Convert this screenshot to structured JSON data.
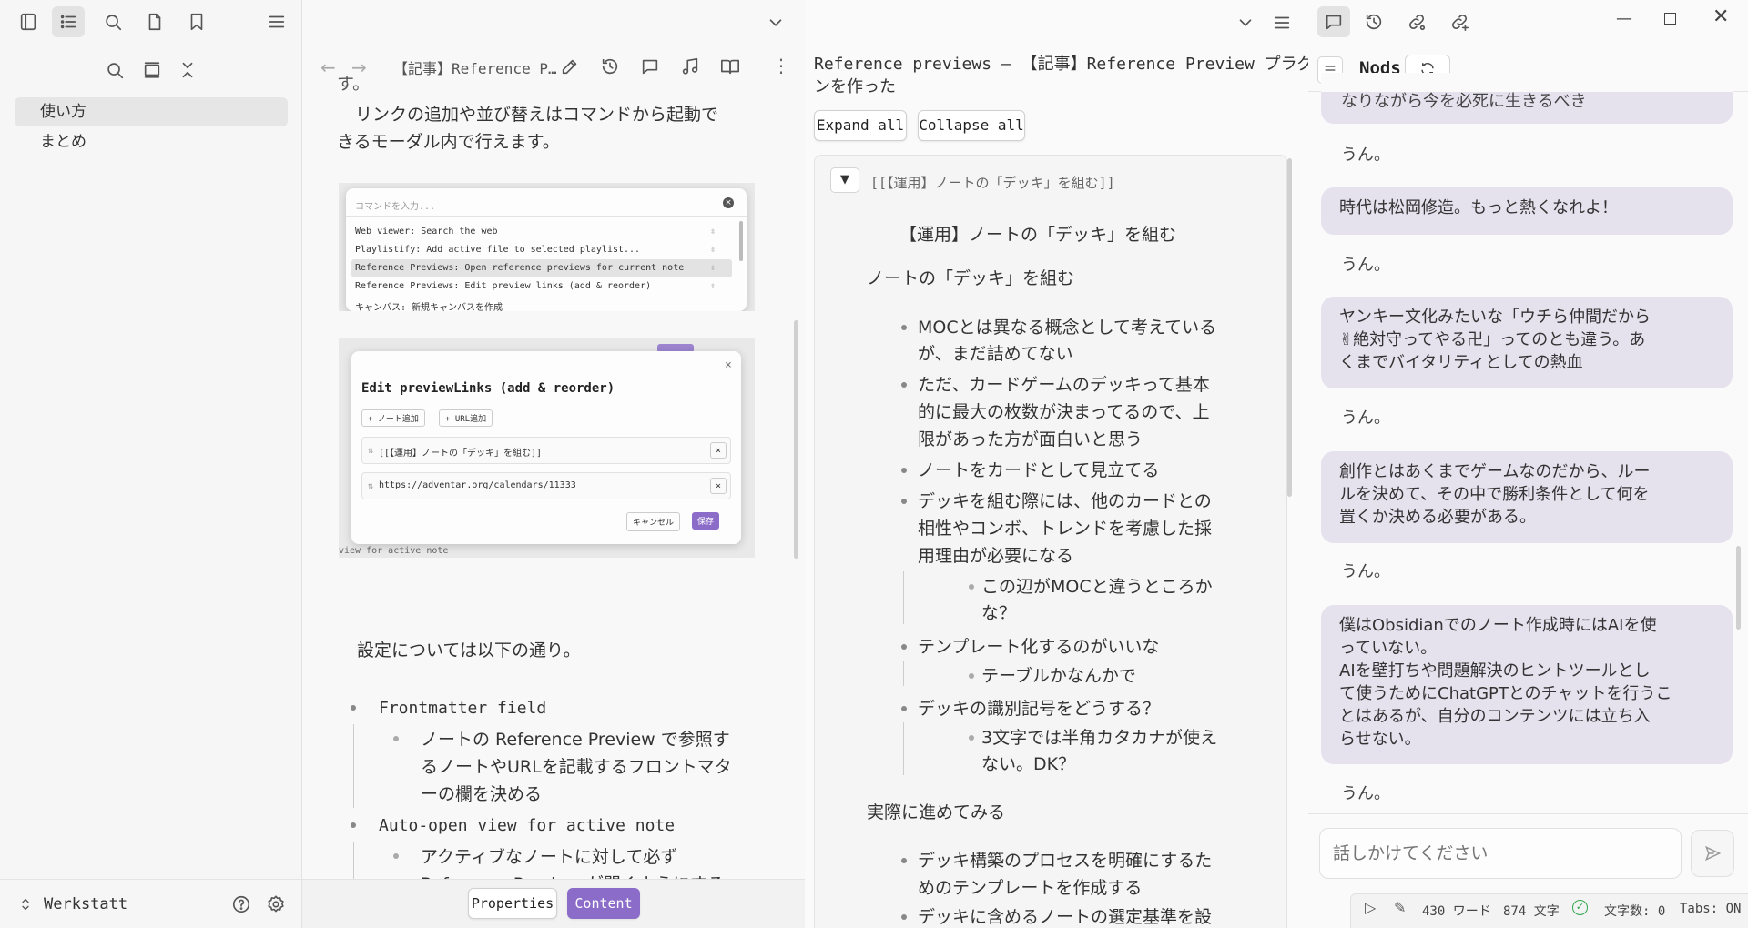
{
  "sidebar": {
    "items": [
      {
        "label": "使い方",
        "selected": true
      },
      {
        "label": "まとめ",
        "selected": false
      }
    ],
    "vault_name": "Werkstatt"
  },
  "pane1": {
    "title": "【記事】Reference P…",
    "partial_top": "す。",
    "para1_line1": "リンクの追加や並び替えはコマンドから起動で",
    "para1_line2": "きるモーダル内で行えます。",
    "cmd_shot": {
      "placeholder": "コマンドを入力...",
      "items": [
        "Web viewer: Search the web",
        "Playlistify: Add active file to selected playlist...",
        "Reference Previews: Open reference previews for current note",
        "Reference Previews: Edit preview links (add & reorder)",
        "キャンバス: 新規キャンバスを作成"
      ]
    },
    "edit_shot": {
      "title": "Edit previewLinks (add & reorder)",
      "add_note": "+ ノート追加",
      "add_url": "+ URL追加",
      "link1": "[[【運用】ノートの「デッキ」を組む]]",
      "link2": "https://adventar.org/calendars/11333",
      "cancel": "キャンセル",
      "save": "保存",
      "bg_text": "view for active note"
    },
    "settings_intro": "設定については以下の通り。",
    "list": [
      {
        "label": "Frontmatter field",
        "sub": [
          "ノートの Reference Preview で参照す",
          "るノートやURLを記載するフロントマタ",
          "ーの欄を決める"
        ]
      },
      {
        "label": "Auto-open view for active note",
        "sub": [
          "アクティブなノートに対して必ず",
          "Reference Preview が開くようにする"
        ]
      }
    ],
    "footer": {
      "properties": "Properties",
      "content": "Content"
    }
  },
  "pane2": {
    "title_line1": "Reference previews – 【記事】Reference Preview プラグイ",
    "title_line2": "ンを作った",
    "expand_all": "Expand all",
    "collapse_all": "Collapse all",
    "card_link": "[[【運用】ノートの「デッキ」を組む]]",
    "heading1": "【運用】ノートの「デッキ」を組む",
    "heading2": "ノートの「デッキ」を組む",
    "b1": [
      "MOCとは異なる概念として考えている",
      "が、まだ詰めてない"
    ],
    "b2": [
      "ただ、カードゲームのデッキって基本",
      "的に最大の枚数が決まってるので、上",
      "限があった方が面白いと思う"
    ],
    "b3": "ノートをカードとして見立てる",
    "b4": [
      "デッキを組む際には、他のカードとの",
      "相性やコンボ、トレンドを考慮した採",
      "用理由が必要になる"
    ],
    "b4_sub": [
      "この辺がMOCと違うところか",
      "な？"
    ],
    "b5": "テンプレート化するのがいいな",
    "b5_sub": "テーブルかなんかで",
    "b6": "デッキの識別記号をどうする？",
    "b6_sub": [
      "3文字では半角カタカナが使え",
      "ない。DK？"
    ],
    "heading3": "実際に進めてみる",
    "b7": [
      "デッキ構築のプロセスを明確にするた",
      "めのテンプレートを作成する"
    ],
    "b8": "デッキに含めるノートの選定基準を設"
  },
  "pane3": {
    "title": "Nods",
    "partial_top": "なりながら今を必死に生きるべき",
    "messages": [
      {
        "lines": [
          "時代は松岡修造。もっと熱くなれよ！"
        ]
      },
      {
        "lines": [
          "ヤンキー文化みたいな「ウチら仲間だから",
          "✌絶対守ってやる卍」ってのとも違う。あ",
          "くまでバイタリティとしての熱血"
        ]
      },
      {
        "lines": [
          "創作とはあくまでゲームなのだから、ルー",
          "ルを決めて、その中で勝利条件として何を",
          "置くか決める必要がある。"
        ]
      },
      {
        "lines": [
          "僕はObsidianでのノート作成時にはAIを使",
          "っていない。",
          "AIを壁打ちや問題解決のヒントツールとし",
          "て使うためにChatGPTとのチャットを行うこ",
          "とはあるが、自分のコンテンツには立ち入",
          "らせない。"
        ]
      }
    ],
    "reply": "うん。",
    "input_placeholder": "話しかけてください"
  },
  "status": {
    "words": "430 ワード",
    "chars": "874 文字",
    "char_count": "文字数: 0",
    "tabs": "Tabs: ON"
  },
  "colors": {
    "accent": "#8b6cc9",
    "bubble": "#e5e2ee"
  }
}
